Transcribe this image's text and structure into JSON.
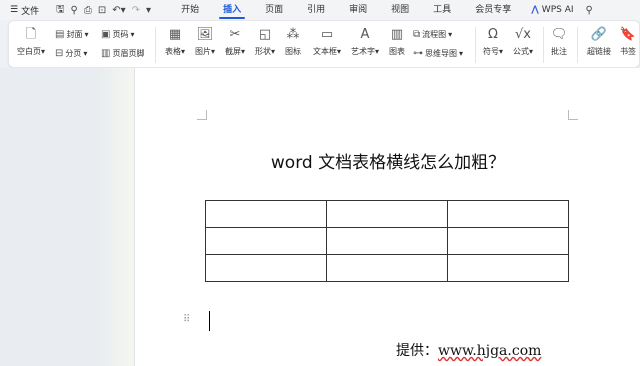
{
  "menubar": {
    "file_label": "文件",
    "tabs": [
      {
        "label": "开始"
      },
      {
        "label": "插入"
      },
      {
        "label": "页面"
      },
      {
        "label": "引用"
      },
      {
        "label": "审阅"
      },
      {
        "label": "视图"
      },
      {
        "label": "工具"
      },
      {
        "label": "会员专享"
      }
    ],
    "active_tab": "插入",
    "wps_ai_label": "WPS AI"
  },
  "ribbon": {
    "blank_page": "空白页",
    "cover": "封面",
    "page_break": "分页",
    "page_number": "页码",
    "header_footer": "页眉页脚",
    "table": "表格",
    "picture": "图片",
    "screenshot": "截屏",
    "shape": "形状",
    "icon": "图标",
    "textbox": "文本框",
    "wordart": "艺术字",
    "chart": "图表",
    "flowchart": "流程图",
    "mindmap": "思维导图",
    "symbol": "符号",
    "formula": "公式",
    "comment": "批注",
    "hyperlink": "超链接",
    "bookmark": "书签"
  },
  "document": {
    "title": "word 文档表格横线怎么加粗？",
    "table_rows": 3,
    "table_cols": 3,
    "credit_prefix": "提供：",
    "credit_url": "www.hjga.com"
  },
  "colors": {
    "accent": "#1d5bd8",
    "menubar_bg": "#f3f4f6",
    "page_bg": "#ffffff"
  }
}
